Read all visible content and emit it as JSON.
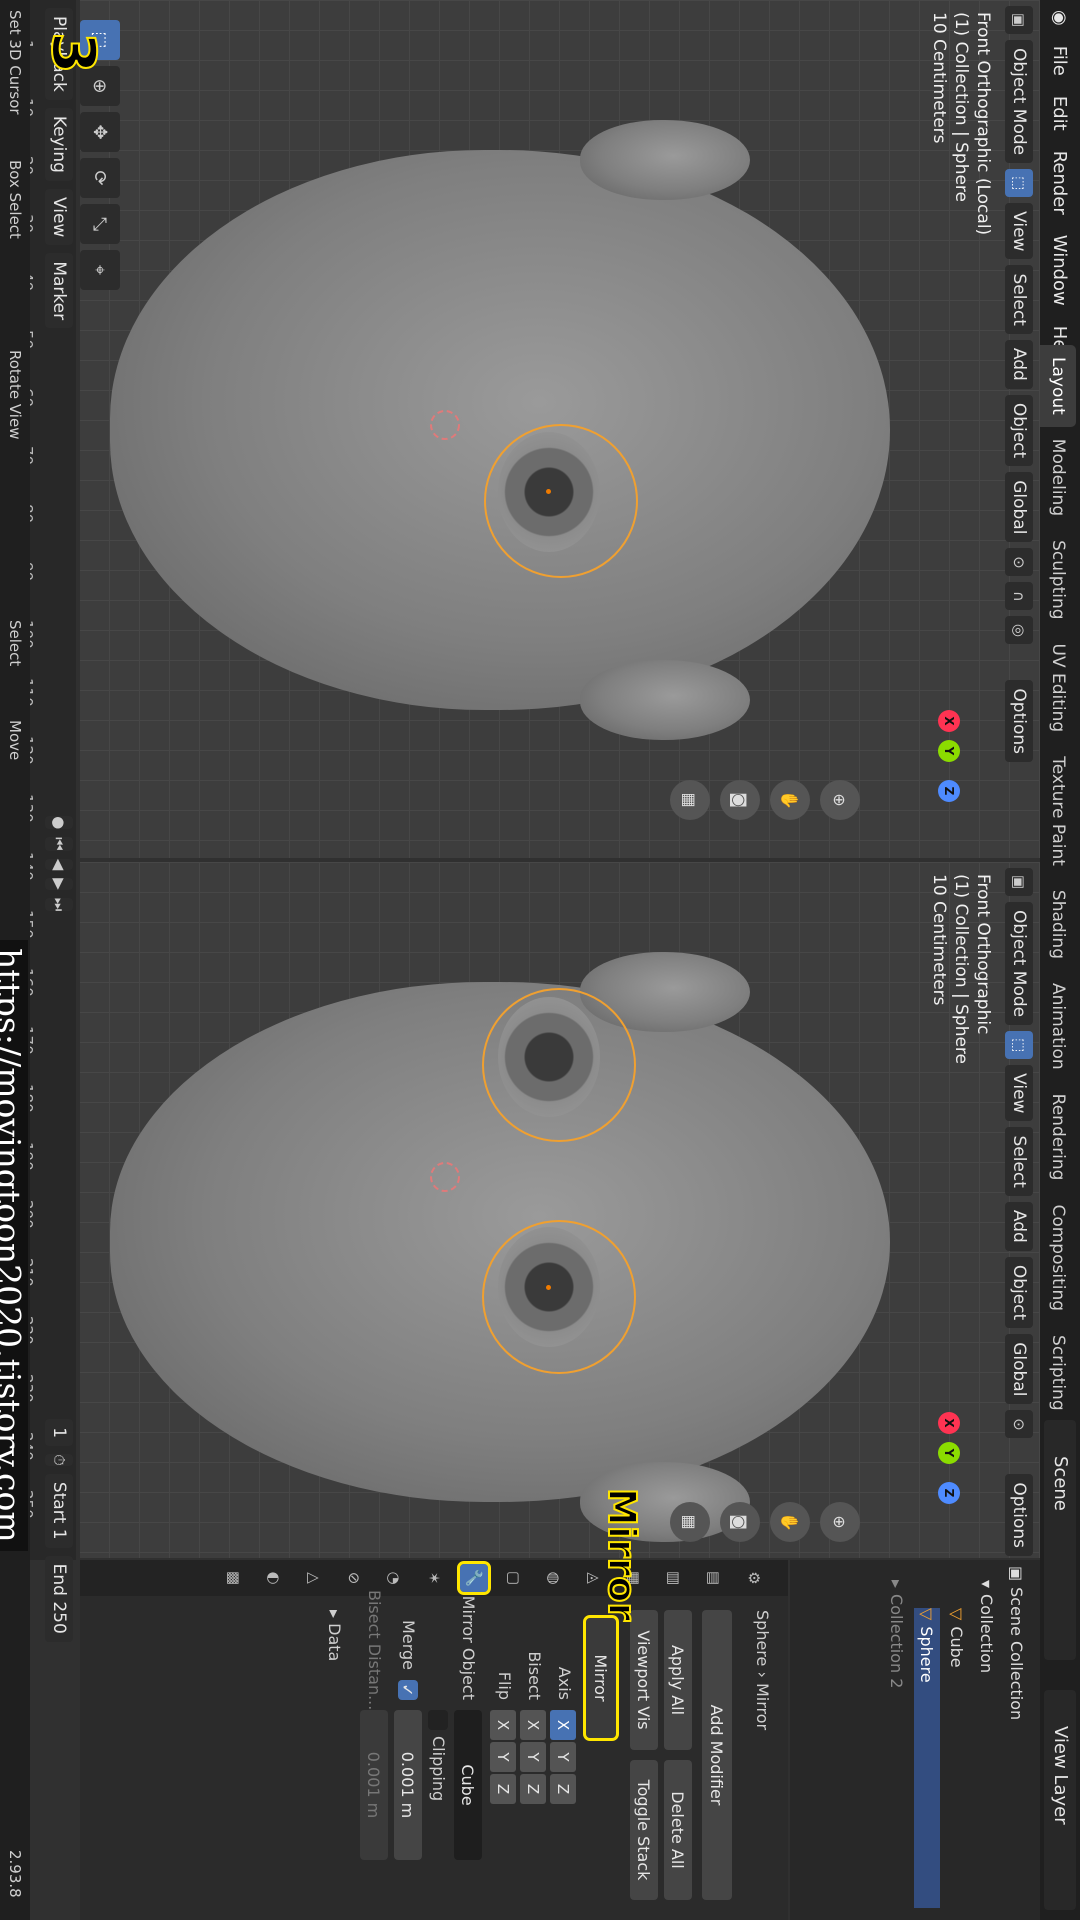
{
  "menu": {
    "items": [
      "File",
      "Edit",
      "Render",
      "Window",
      "Help"
    ]
  },
  "workspaces": [
    "Layout",
    "Modeling",
    "Sculpting",
    "UV Editing",
    "Texture Paint",
    "Shading",
    "Animation",
    "Rendering",
    "Compositing",
    "Scripting",
    "+"
  ],
  "scene": {
    "label": "Scene",
    "view_layer": "View Layer"
  },
  "viewport_left": {
    "mode": "Object Mode",
    "menus": [
      "View",
      "Select",
      "Add",
      "Object"
    ],
    "orientation": "Global",
    "options": "Options",
    "overlay_lines": [
      "Front Orthographic (Local)",
      "(1) Collection | Sphere",
      "10 Centimeters"
    ]
  },
  "viewport_right": {
    "mode": "Object Mode",
    "menus": [
      "View",
      "Select",
      "Add",
      "Object"
    ],
    "orientation": "Global",
    "options": "Options",
    "overlay_lines": [
      "Front Orthographic",
      "(1) Collection | Sphere",
      "10 Centimeters"
    ]
  },
  "gizmo": {
    "x": "X",
    "y": "Y",
    "z": "Z"
  },
  "outliner": {
    "title": "Scene Collection",
    "collection": "Collection",
    "items": [
      "Cube",
      "Sphere"
    ],
    "collection2": "Collection 2"
  },
  "properties": {
    "object": "Sphere",
    "modifier_breadcrumb": "Mirror",
    "add_modifier": "Add Modifier",
    "apply_all": "Apply All",
    "delete_all": "Delete All",
    "viewport_vis": "Viewport Vis",
    "toggle_stack": "Toggle Stack",
    "modifier_name": "Mirror",
    "axis_label": "Axis",
    "bisect_label": "Bisect",
    "flip_label": "Flip",
    "axes": [
      "X",
      "Y",
      "Z"
    ],
    "axis_active": "X",
    "mirror_object_label": "Mirror Object",
    "mirror_object": "Cube",
    "clipping_label": "Clipping",
    "merge_label": "Merge",
    "merge_value": "0.001 m",
    "bisect_distance_label": "Bisect Distan...",
    "bisect_distance_value": "0.001 m",
    "data_label": "Data",
    "callout": "Mirror"
  },
  "timeline": {
    "menus": [
      "Playback",
      "Keying",
      "View",
      "Marker"
    ],
    "frame": "1",
    "current_frame_field": "1",
    "start_label": "Start",
    "start": "1",
    "end_label": "End",
    "end": "250",
    "ticks": [
      "1",
      "10",
      "20",
      "30",
      "40",
      "50",
      "60",
      "70",
      "80",
      "90",
      "100",
      "110",
      "120",
      "130",
      "140",
      "150",
      "160",
      "170",
      "180",
      "190",
      "200",
      "210",
      "220",
      "230",
      "240",
      "250"
    ]
  },
  "status": {
    "set_cursor": "Set 3D Cursor",
    "box_select": "Box Select",
    "rotate_view": "Rotate View",
    "select": "Select",
    "move": "Move",
    "version": "2.93.8"
  },
  "watermark": "https://movingtoon2020.tistory.com",
  "step": "3",
  "colors": {
    "accent": "#4772b3",
    "highlight": "#ffe600",
    "selection": "#f0a030"
  }
}
